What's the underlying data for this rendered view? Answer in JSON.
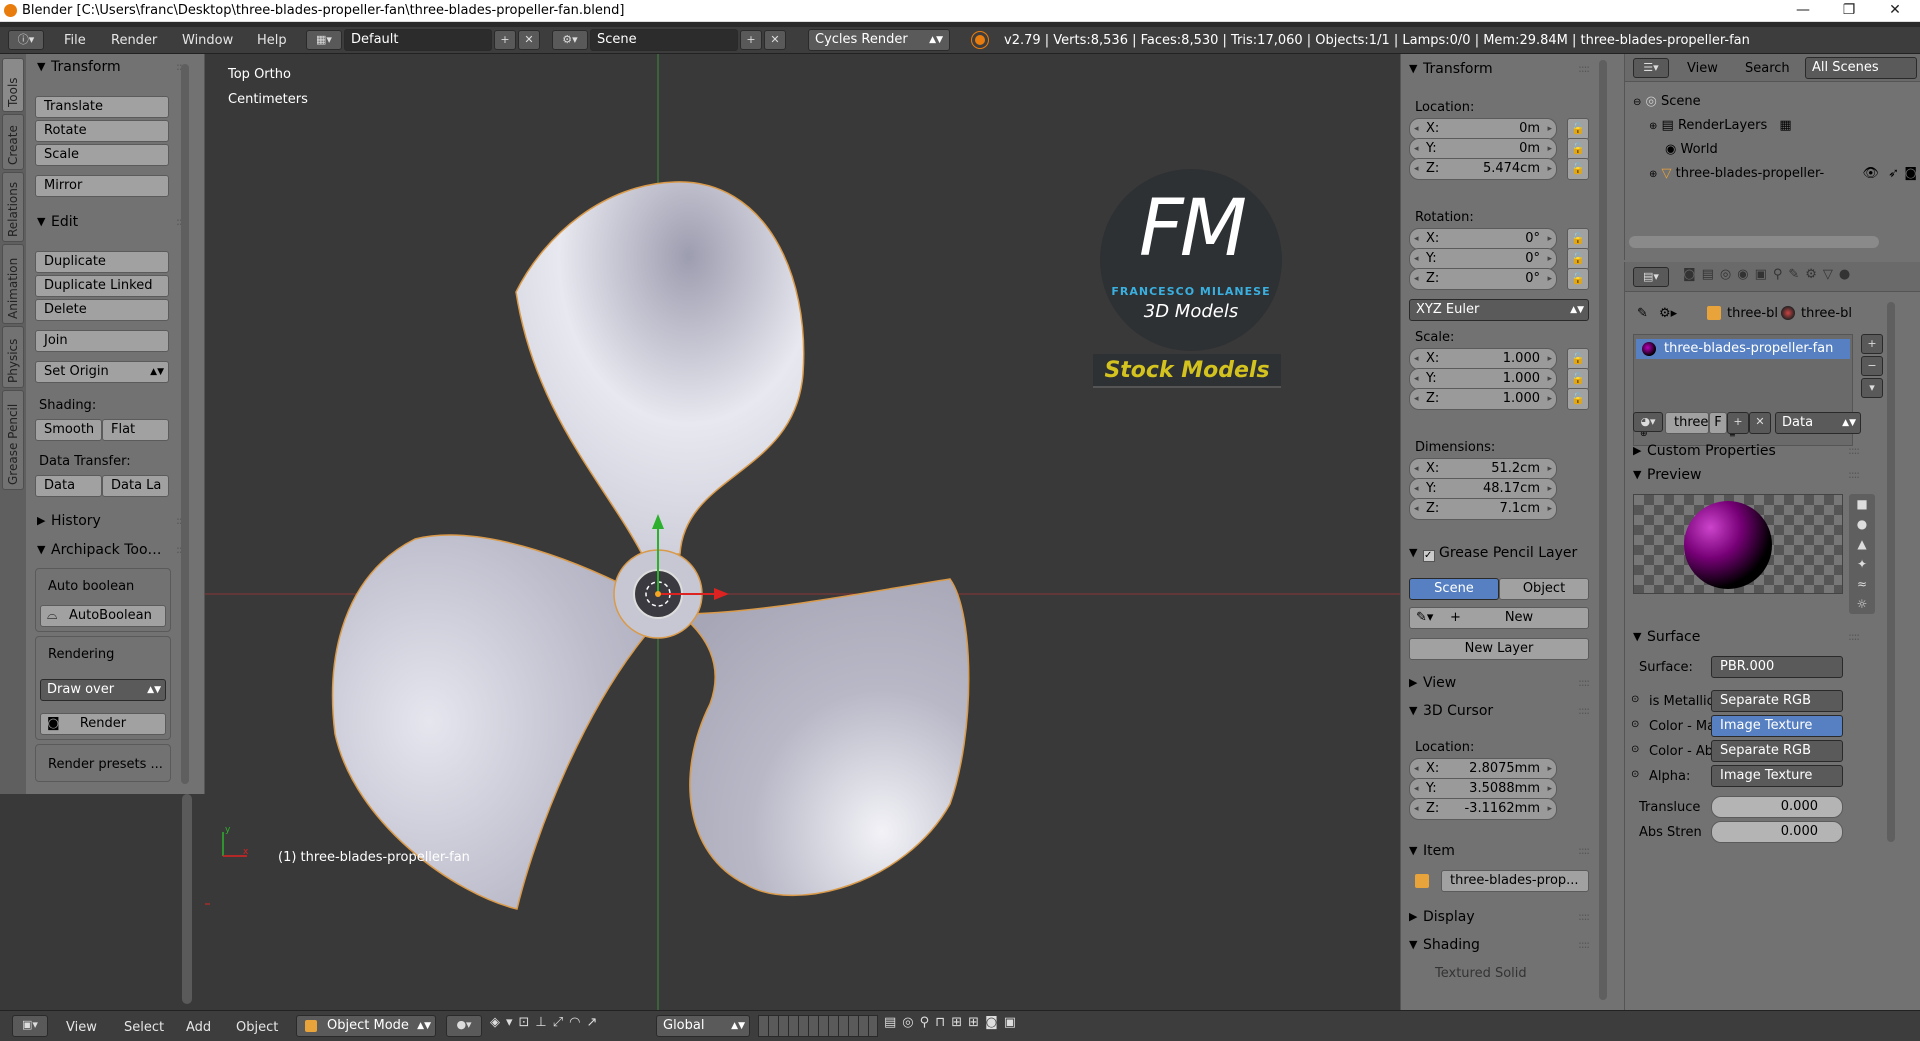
{
  "titlebar": {
    "title": "Blender [C:\\Users\\franc\\Desktop\\three-blades-propeller-fan\\three-blades-propeller-fan.blend]",
    "minimize": "—",
    "maximize": "❐",
    "close": "✕"
  },
  "menu": {
    "items": [
      "File",
      "Render",
      "Window",
      "Help"
    ],
    "layout": "Default",
    "scene": "Scene",
    "engine": "Cycles Render",
    "stats": "v2.79 | Verts:8,536 | Faces:8,530 | Tris:17,060 | Objects:1/1 | Lamps:0/0 | Mem:29.84M | three-blades-propeller-fan"
  },
  "tabs": [
    "Tools",
    "Create",
    "Relations",
    "Animation",
    "Physics",
    "Grease Pencil"
  ],
  "toolshelf": {
    "transform": {
      "title": "Transform",
      "buttons": [
        "Translate",
        "Rotate",
        "Scale",
        "Mirror"
      ]
    },
    "edit": {
      "title": "Edit",
      "buttons": [
        "Duplicate",
        "Duplicate Linked",
        "Delete",
        "Join"
      ],
      "set_origin": "Set Origin",
      "shading_label": "Shading:",
      "smooth": "Smooth",
      "flat": "Flat",
      "data_transfer_label": "Data Transfer:",
      "data": "Data",
      "data_la": "Data La"
    },
    "history": "History",
    "archipack": {
      "title": "Archipack Too…",
      "auto_boolean_label": "Auto boolean",
      "auto_boolean_btn": "AutoBoolean",
      "rendering_label": "Rendering",
      "draw_over": "Draw over",
      "render": "Render",
      "render_presets": "Render presets ..."
    }
  },
  "viewport": {
    "view_name": "Top Ortho",
    "units": "Centimeters",
    "object_label": "(1) three-blades-propeller-fan",
    "logo_letters": "FM",
    "logo_name": "FRANCESCO MILANESE",
    "logo_sub": "3D Models",
    "stock": "Stock Models"
  },
  "npanel": {
    "transform_title": "Transform",
    "location_label": "Location:",
    "location": [
      {
        "k": "X:",
        "v": "0m"
      },
      {
        "k": "Y:",
        "v": "0m"
      },
      {
        "k": "Z:",
        "v": "5.474cm"
      }
    ],
    "rotation_label": "Rotation:",
    "rotation": [
      {
        "k": "X:",
        "v": "0°"
      },
      {
        "k": "Y:",
        "v": "0°"
      },
      {
        "k": "Z:",
        "v": "0°"
      }
    ],
    "rotation_mode": "XYZ Euler",
    "scale_label": "Scale:",
    "scale": [
      {
        "k": "X:",
        "v": "1.000"
      },
      {
        "k": "Y:",
        "v": "1.000"
      },
      {
        "k": "Z:",
        "v": "1.000"
      }
    ],
    "dimensions_label": "Dimensions:",
    "dimensions": [
      {
        "k": "X:",
        "v": "51.2cm"
      },
      {
        "k": "Y:",
        "v": "48.17cm"
      },
      {
        "k": "Z:",
        "v": "7.1cm"
      }
    ],
    "gp_title": "Grease Pencil Layer",
    "gp_scene": "Scene",
    "gp_object": "Object",
    "gp_new": "New",
    "gp_new_layer": "New Layer",
    "view_title": "View",
    "cursor_title": "3D Cursor",
    "cursor_location_label": "Location:",
    "cursor": [
      {
        "k": "X:",
        "v": "2.8075mm"
      },
      {
        "k": "Y:",
        "v": "3.5088mm"
      },
      {
        "k": "Z:",
        "v": "-3.1162mm"
      }
    ],
    "item_title": "Item",
    "item_name": "three-blades-prop...",
    "display_title": "Display",
    "shading_title": "Shading",
    "textured_solid": "Textured Solid"
  },
  "outliner": {
    "view": "View",
    "search": "Search",
    "all_scenes": "All Scenes",
    "items": [
      "Scene",
      "RenderLayers",
      "World",
      "three-blades-propeller-"
    ]
  },
  "props": {
    "crumb1": "three-bl",
    "crumb2": "three-bl",
    "material": "three-blades-propeller-fan",
    "mat_short": "three",
    "mat_f": "F",
    "data": "Data",
    "custom_props": "Custom Properties",
    "preview": "Preview",
    "surface": "Surface",
    "surface_label": "Surface:",
    "surface_value": "PBR.000",
    "rows": [
      {
        "k": "is Metallic",
        "v": "Separate RGB",
        "sel": false
      },
      {
        "k": "Color - Ma",
        "v": "Image Texture",
        "sel": true
      },
      {
        "k": "Color - Ab",
        "v": "Separate RGB",
        "sel": false
      },
      {
        "k": "Alpha:",
        "v": "Image Texture",
        "sel": false
      }
    ],
    "transluce_label": "Transluce",
    "transluce_value": "0.000",
    "abs_label": "Abs Stren",
    "abs_value": "0.000"
  },
  "bottombar": {
    "view": "View",
    "select": "Select",
    "add": "Add",
    "object": "Object",
    "mode": "Object Mode",
    "orientation": "Global"
  }
}
